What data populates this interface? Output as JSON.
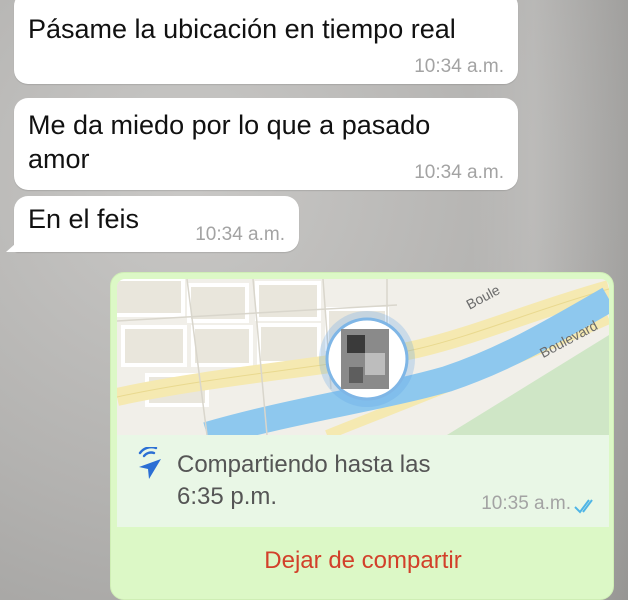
{
  "messages": [
    {
      "text": "Pásame la ubicación en tiempo real",
      "time": "10:34 a.m."
    },
    {
      "text": "Me da miedo por lo que a pasado amor",
      "time": "10:34 a.m."
    },
    {
      "text": "En el feis",
      "time": "10:34 a.m."
    }
  ],
  "live_location": {
    "map_labels": [
      "Boule",
      "Boulevard"
    ],
    "sharing_text": "Compartiendo hasta las 6:35 p.m.",
    "time": "10:35 a.m.",
    "read_status_icon": "double-check-icon",
    "stop_label": "Dejar de compartir"
  },
  "colors": {
    "outgoing_bubble": "#dcf8c6",
    "incoming_bubble": "#ffffff",
    "stop_text": "#d2402a",
    "read_ticks": "#4fb5e6",
    "share_icon": "#2b6fd4",
    "river": "#8ec8ee",
    "road": "#f2e9b8"
  }
}
